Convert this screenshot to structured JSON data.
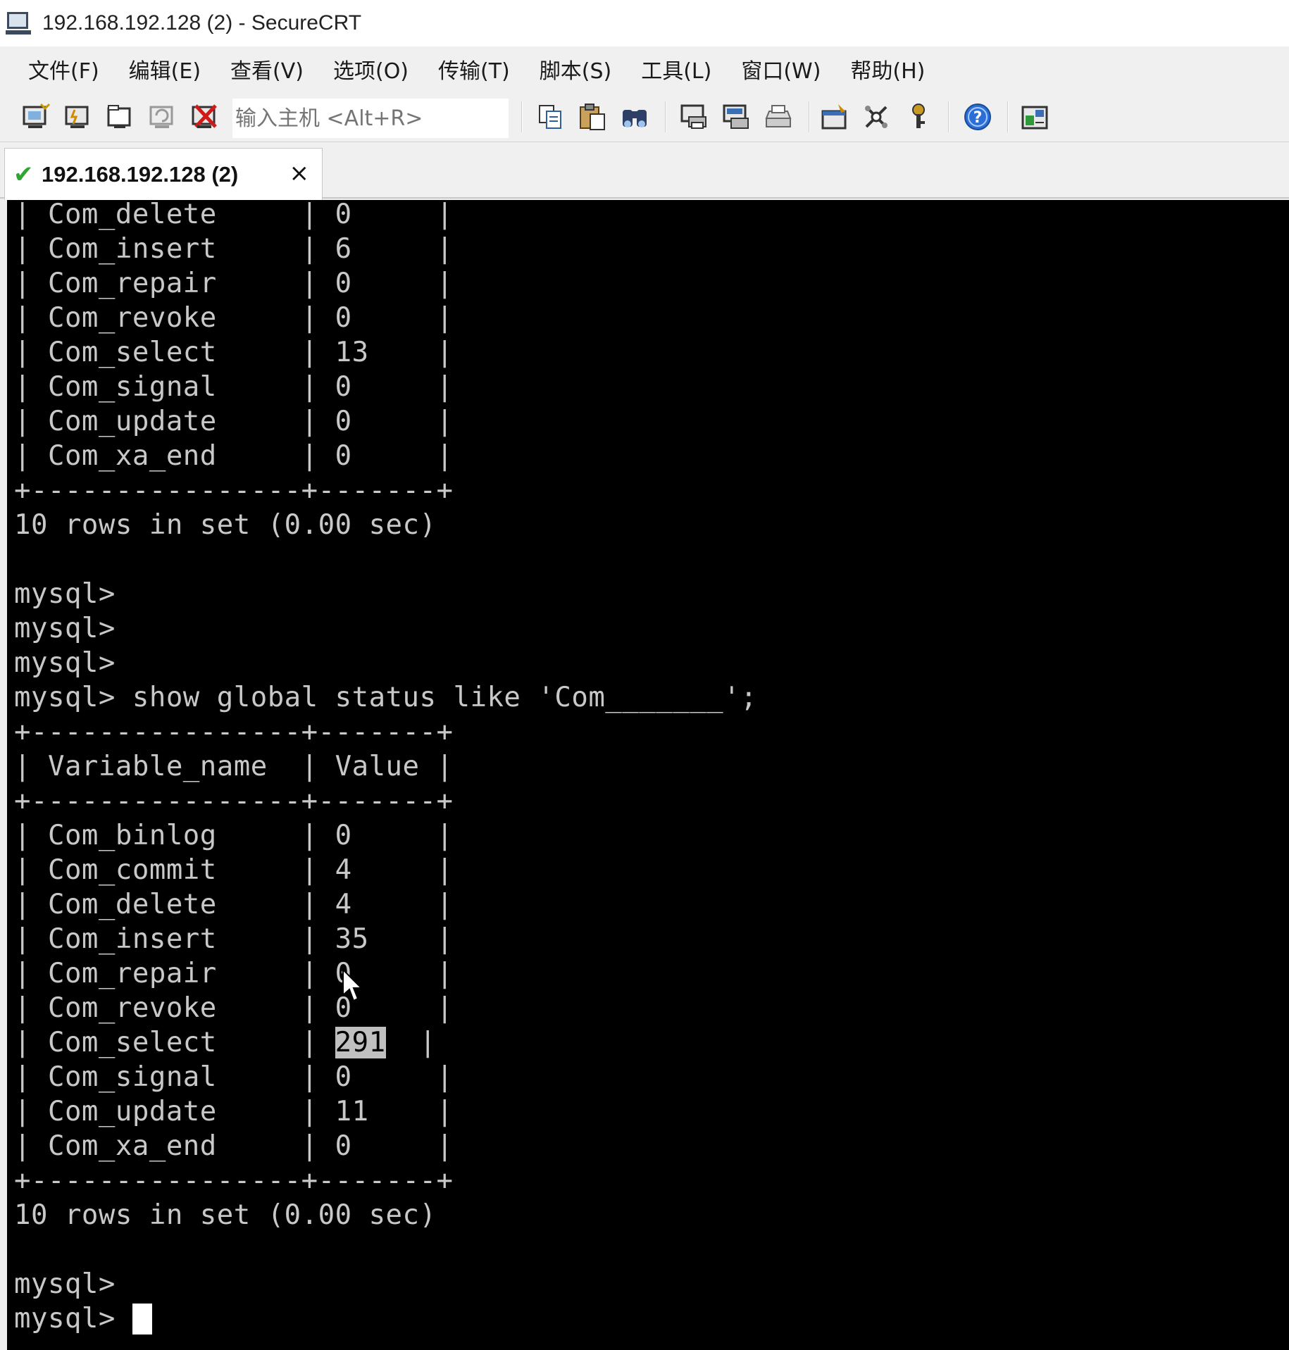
{
  "window": {
    "title": "192.168.192.128 (2) - SecureCRT"
  },
  "menu": [
    {
      "label": "文件(F)"
    },
    {
      "label": "编辑(E)"
    },
    {
      "label": "查看(V)"
    },
    {
      "label": "选项(O)"
    },
    {
      "label": "传输(T)"
    },
    {
      "label": "脚本(S)"
    },
    {
      "label": "工具(L)"
    },
    {
      "label": "窗口(W)"
    },
    {
      "label": "帮助(H)"
    }
  ],
  "toolbar": {
    "host_placeholder": "输入主机 <Alt+R>",
    "icons": [
      "connect-icon",
      "quick-connect-icon",
      "connect-in-tab-icon",
      "reconnect-icon",
      "disconnect-icon",
      "copy-icon",
      "paste-icon",
      "find-icon",
      "print-icon",
      "print-selection-icon",
      "print-setup-icon",
      "session-options-icon",
      "global-options-icon",
      "keymap-icon",
      "help-icon",
      "sftp-icon"
    ]
  },
  "tab": {
    "label": "192.168.192.128 (2)",
    "status": "connected",
    "close_glyph": "×"
  },
  "terminal": {
    "lines": [
      "| Com_delete     | 0     |",
      "| Com_insert     | 6     |",
      "| Com_repair     | 0     |",
      "| Com_revoke     | 0     |",
      "| Com_select     | 13    |",
      "| Com_signal     | 0     |",
      "| Com_update     | 0     |",
      "| Com_xa_end     | 0     |",
      "+----------------+-------+",
      "10 rows in set (0.00 sec)",
      "",
      "mysql>",
      "mysql>",
      "mysql>",
      "mysql> show global status like 'Com_______';",
      "+----------------+-------+",
      "| Variable_name  | Value |",
      "+----------------+-------+",
      "| Com_binlog     | 0     |",
      "| Com_commit     | 4     |",
      "| Com_delete     | 4     |",
      "| Com_insert     | 35    |",
      "| Com_repair     | 0     |",
      "| Com_revoke     | 0     |",
      "| Com_select     | ",
      "| Com_signal     | 0     |",
      "| Com_update     | 11    |",
      "| Com_xa_end     | 0     |",
      "+----------------+-------+",
      "10 rows in set (0.00 sec)",
      "",
      "mysql>",
      "mysql> "
    ],
    "selected_value": "291",
    "selected_row_tail": "  |"
  },
  "colors": {
    "terminal_bg": "#000000",
    "terminal_fg": "#c8c8c8",
    "selection_bg": "#c0c0c0",
    "connected_check": "#2fa534"
  }
}
